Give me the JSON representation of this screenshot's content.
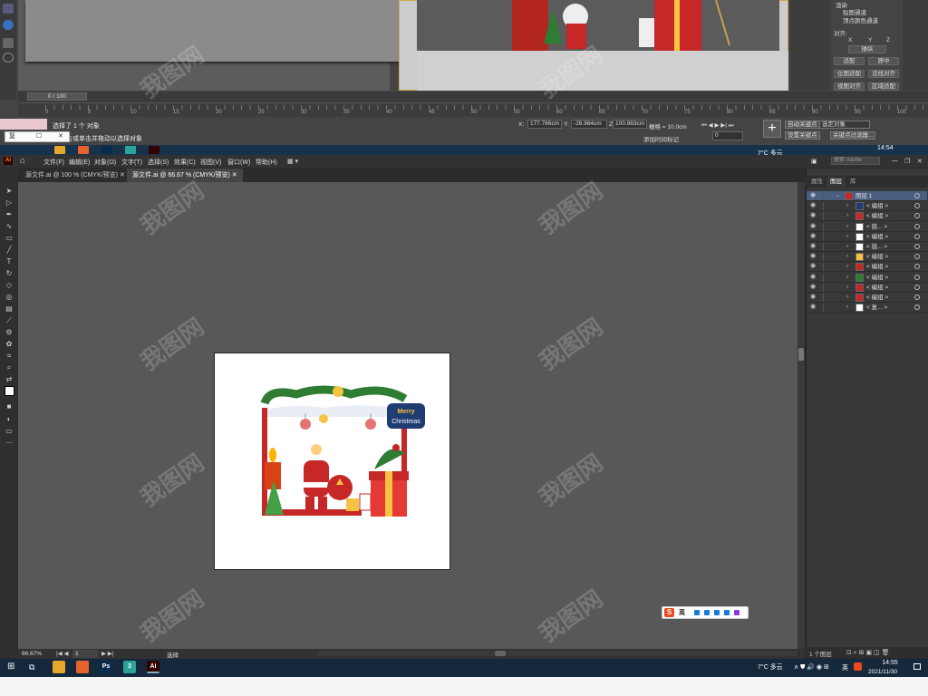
{
  "max": {
    "time_field": "0 / 100",
    "ruler_ticks": [
      "0",
      "5",
      "10",
      "15",
      "20",
      "25",
      "30",
      "35",
      "40",
      "45",
      "50",
      "55",
      "60",
      "65",
      "70",
      "75",
      "80",
      "85",
      "90",
      "95",
      "100"
    ],
    "status_selected": "选择了 1 个 对象",
    "status_hint": "单击或单击并拖动以选择对象",
    "mini_window_title": "复",
    "coord_x_label": "X:",
    "coord_x": "177.766cm",
    "coord_y_label": "Y:",
    "coord_y": "-26.964cm",
    "coord_z_label": "Z:",
    "coord_z": "100.883cm",
    "grid_label": "栅格 = 10.0cm",
    "add_time_tag": "添加时间标记",
    "frame_value": "0",
    "auto_key": "自动关键点",
    "selected_obj": "选定对象",
    "set_key": "设置关键点",
    "key_filter": "关键点过滤器...",
    "cmd": {
      "title": "渲染",
      "opt1": "贴图通道",
      "opt2": "顶点颜色通道",
      "align_label": "对齐:",
      "align_x": "X",
      "align_y": "Y",
      "align_z": "Z",
      "manip": "操纵",
      "fit": "适配",
      "center": "居中",
      "bitmap_fit": "位图适配",
      "normal_align": "法线对齐",
      "view_align": "视图对齐",
      "region_fit": "区域适配"
    },
    "clock": "14:54",
    "weather": "7°C  多云"
  },
  "ai": {
    "logo": "Ai",
    "menus": [
      "文件(F)",
      "编辑(E)",
      "对象(O)",
      "文字(T)",
      "选择(S)",
      "效果(C)",
      "视图(V)",
      "窗口(W)",
      "帮助(H)"
    ],
    "search_placeholder": "搜索 Adobe",
    "tabs": [
      "源文件.ai @ 100 % (CMYK/预览)",
      "源文件.ai @ 66.67 % (CMYK/预览)"
    ],
    "zoom": "66.67%",
    "page": "1",
    "status_tool": "选择",
    "artwork_text": "Merry Christmas",
    "panel": {
      "tabs": [
        "属性",
        "图层",
        "库"
      ],
      "active_tab": "图层",
      "layers": [
        {
          "name": "图层 1",
          "top": true
        },
        {
          "name": "< 编组 >"
        },
        {
          "name": "< 编组 >"
        },
        {
          "name": "< 链... >"
        },
        {
          "name": "< 编组 >"
        },
        {
          "name": "< 链... >"
        },
        {
          "name": "< 编组 >"
        },
        {
          "name": "< 编组 >"
        },
        {
          "name": "< 编组 >"
        },
        {
          "name": "< 编组 >"
        },
        {
          "name": "< 编组 >"
        },
        {
          "name": "< 复... >"
        }
      ],
      "footer": "1 个图层"
    }
  },
  "ime": {
    "logo": "S",
    "lang": "英"
  },
  "taskbar": {
    "apps": [
      {
        "name": "文件资源管理器",
        "color": "#e6a82a",
        "label": ""
      },
      {
        "name": "Firefox",
        "color": "#e8632b",
        "label": ""
      },
      {
        "name": "Photoshop",
        "color": "#0b2b4a",
        "label": "Ps"
      },
      {
        "name": "3ds Max",
        "color": "#2aa39a",
        "label": "3"
      },
      {
        "name": "Illustrator",
        "color": "#330000",
        "label": "Ai"
      }
    ],
    "weather": "7°C  多云",
    "lang": "英",
    "time": "14:55",
    "date": "2021/11/30"
  },
  "watermark": "我图网"
}
